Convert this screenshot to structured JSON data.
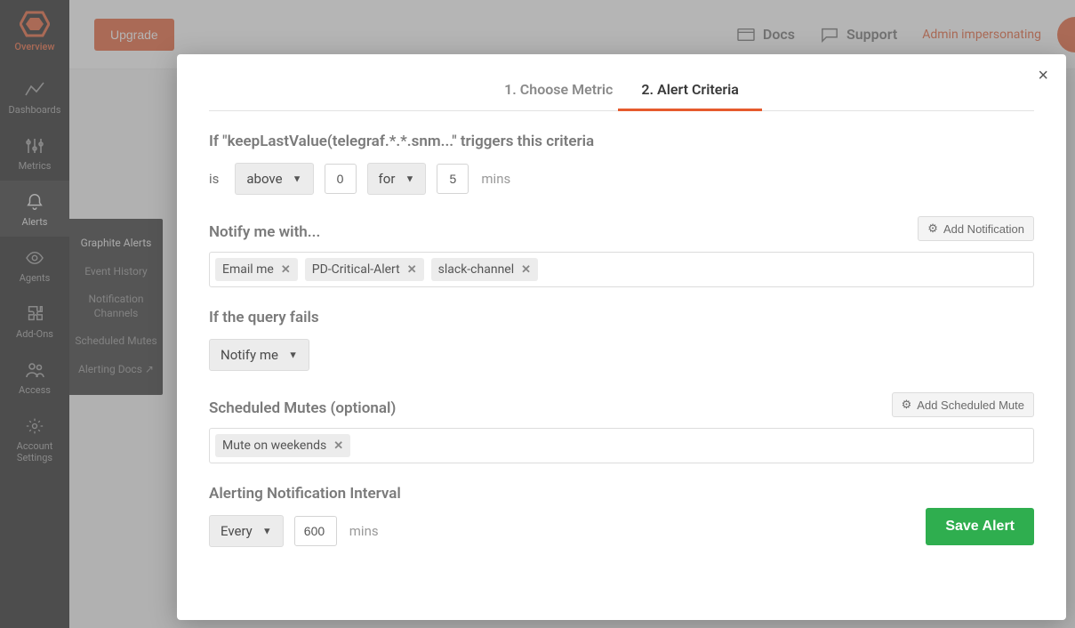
{
  "brand": {
    "label": "Overview"
  },
  "sidebar": {
    "items": [
      {
        "label": "Dashboards"
      },
      {
        "label": "Metrics"
      },
      {
        "label": "Alerts"
      },
      {
        "label": "Agents"
      },
      {
        "label": "Add-Ons"
      },
      {
        "label": "Access"
      },
      {
        "label": "Account Settings"
      }
    ]
  },
  "submenu": {
    "items": [
      {
        "label": "Graphite Alerts"
      },
      {
        "label": "Event History"
      },
      {
        "label": "Notification Channels"
      },
      {
        "label": "Scheduled Mutes"
      },
      {
        "label": "Alerting Docs ↗"
      }
    ]
  },
  "topbar": {
    "upgrade": "Upgrade",
    "docs": "Docs",
    "support": "Support",
    "impersonate": "Admin impersonating"
  },
  "modal": {
    "tabs": [
      {
        "label": "1. Choose Metric"
      },
      {
        "label": "2. Alert Criteria"
      }
    ],
    "criteria_heading": "If \"keepLastValue(telegraf.*.*.snm...\" triggers this criteria",
    "is_label": "is",
    "comparator": "above",
    "threshold_value": "0",
    "for_label": "for",
    "for_option": "",
    "duration_value": "5",
    "duration_unit": "mins",
    "notify_heading": "Notify me with...",
    "add_notification": "Add Notification",
    "notify_chips": [
      {
        "label": "Email me"
      },
      {
        "label": "PD-Critical-Alert"
      },
      {
        "label": "slack-channel"
      }
    ],
    "query_fail_heading": "If the query fails",
    "query_fail_option": "Notify me",
    "mutes_heading": "Scheduled Mutes (optional)",
    "add_mute": "Add Scheduled Mute",
    "mute_chips": [
      {
        "label": "Mute on weekends"
      }
    ],
    "interval_heading": "Alerting Notification Interval",
    "interval_mode": "Every",
    "interval_value": "600",
    "interval_unit": "mins",
    "save": "Save Alert"
  }
}
